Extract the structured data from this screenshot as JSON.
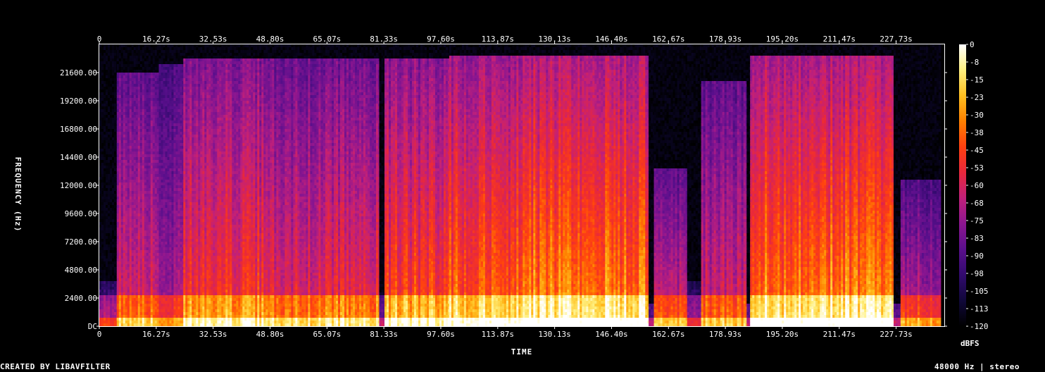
{
  "chart_data": {
    "type": "heatmap",
    "title": "",
    "xlabel": "TIME",
    "ylabel": "FREQUENCY (Hz)",
    "colorbar_label": "dBFS",
    "x_unit": "s",
    "xlim": [
      0,
      241.5
    ],
    "ylim": [
      0,
      24000
    ],
    "zlim": [
      -120,
      0
    ],
    "x_ticks": [
      "0",
      "16.27s",
      "32.53s",
      "48.80s",
      "65.07s",
      "81.33s",
      "97.60s",
      "113.87s",
      "130.13s",
      "146.40s",
      "162.67s",
      "178.93s",
      "195.20s",
      "211.47s",
      "227.73s"
    ],
    "x_tick_values": [
      0,
      16.27,
      32.53,
      48.8,
      65.07,
      81.33,
      97.6,
      113.87,
      130.13,
      146.4,
      162.67,
      178.93,
      195.2,
      211.47,
      227.73
    ],
    "y_ticks": [
      "DC",
      "2400.00",
      "4800.00",
      "7200.00",
      "9600.00",
      "12000.00",
      "14400.00",
      "16800.00",
      "19200.00",
      "21600.00"
    ],
    "y_tick_values": [
      0,
      2400,
      4800,
      7200,
      9600,
      12000,
      14400,
      16800,
      19200,
      21600
    ],
    "colorbar_ticks": [
      "0",
      "-8",
      "-15",
      "-23",
      "-30",
      "-38",
      "-45",
      "-53",
      "-60",
      "-68",
      "-75",
      "-83",
      "-90",
      "-98",
      "-105",
      "-113",
      "-120"
    ],
    "colorbar_values": [
      0,
      -7.5,
      -15,
      -22.5,
      -30,
      -37.5,
      -45,
      -52.5,
      -60,
      -67.5,
      -75,
      -82.5,
      -90,
      -97.5,
      -105,
      -112.5,
      -120
    ],
    "colormap": [
      "#000000",
      "#10083a",
      "#320a6e",
      "#5a0f8c",
      "#8c1690",
      "#c0207a",
      "#e8283c",
      "#ff4010",
      "#ff8000",
      "#ffc020",
      "#fff080",
      "#ffffff"
    ],
    "segments": [
      {
        "start": 0,
        "end": 5,
        "level": 0.28,
        "top_khz": 4
      },
      {
        "start": 5,
        "end": 17,
        "level": 0.52,
        "top_khz": 21.6
      },
      {
        "start": 17,
        "end": 24,
        "level": 0.42,
        "top_khz": 22.4
      },
      {
        "start": 24,
        "end": 50,
        "level": 0.62,
        "top_khz": 23
      },
      {
        "start": 50,
        "end": 64,
        "level": 0.54,
        "top_khz": 23
      },
      {
        "start": 64,
        "end": 80,
        "level": 0.57,
        "top_khz": 23
      },
      {
        "start": 80,
        "end": 81.5,
        "level": 0.12,
        "top_khz": 3
      },
      {
        "start": 81.5,
        "end": 100,
        "level": 0.64,
        "top_khz": 23
      },
      {
        "start": 100,
        "end": 118,
        "level": 0.7,
        "top_khz": 23.2
      },
      {
        "start": 118,
        "end": 157,
        "level": 0.76,
        "top_khz": 23.2
      },
      {
        "start": 157,
        "end": 158.5,
        "level": 0.1,
        "top_khz": 2
      },
      {
        "start": 158.5,
        "end": 168,
        "level": 0.5,
        "top_khz": 13.5
      },
      {
        "start": 168,
        "end": 172,
        "level": 0.22,
        "top_khz": 4
      },
      {
        "start": 172,
        "end": 185,
        "level": 0.5,
        "top_khz": 21
      },
      {
        "start": 185,
        "end": 186,
        "level": 0.12,
        "top_khz": 2
      },
      {
        "start": 186,
        "end": 227,
        "level": 0.76,
        "top_khz": 23.2
      },
      {
        "start": 227,
        "end": 229,
        "level": 0.12,
        "top_khz": 2
      },
      {
        "start": 229,
        "end": 240,
        "level": 0.45,
        "top_khz": 12.5
      }
    ]
  },
  "footer": {
    "credit": "CREATED BY LIBAVFILTER",
    "format": "48000 Hz | stereo"
  }
}
